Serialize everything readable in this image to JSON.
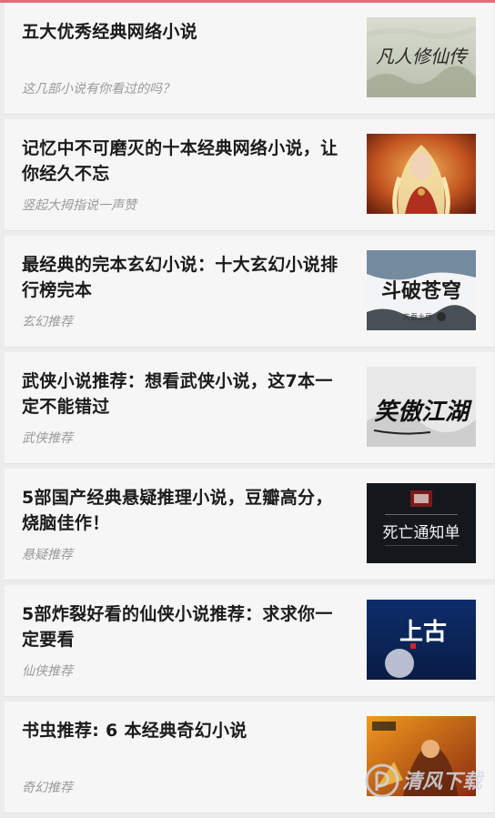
{
  "articles": [
    {
      "title": "五大优秀经典网络小说",
      "subtitle": "这几部小说有你看过的吗？",
      "thumb_text": "凡人修仙传"
    },
    {
      "title": "记忆中不可磨灭的十本经典网络小说，让你经久不忘",
      "subtitle": "竖起大拇指说一声赞",
      "thumb_text": ""
    },
    {
      "title": "最经典的完本玄幻小说：十大玄幻小说排行榜完本",
      "subtitle": "玄幻推荐",
      "thumb_text": "斗破苍穹",
      "thumb_subtext": "天蚕土豆"
    },
    {
      "title": "武侠小说推荐：想看武侠小说，这7本一定不能错过",
      "subtitle": "武侠推荐",
      "thumb_text": "笑傲江湖"
    },
    {
      "title": "5部国产经典悬疑推理小说，豆瓣高分，烧脑佳作！",
      "subtitle": "悬疑推荐",
      "thumb_text": "死亡通知单"
    },
    {
      "title": "5部炸裂好看的仙侠小说推荐：求求你一定要看",
      "subtitle": "仙侠推荐",
      "thumb_text": "上古"
    },
    {
      "title": "书虫推荐: 6 本经典奇幻小说",
      "subtitle": "奇幻推荐",
      "thumb_text": ""
    }
  ],
  "watermark": {
    "text": "清风下载"
  },
  "colors": {
    "accent_top": "#e86a77",
    "title": "#1b1b1b",
    "subtitle": "#9a9a9a",
    "card_bg": "#f6f6f6"
  }
}
